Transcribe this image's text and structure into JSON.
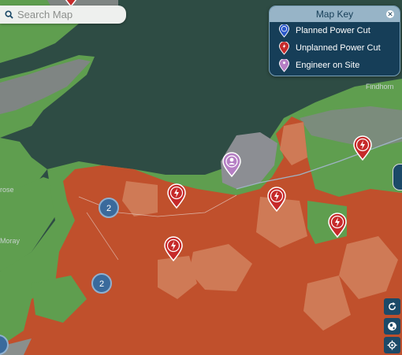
{
  "search": {
    "placeholder": "Search Map"
  },
  "map_key": {
    "title": "Map Key",
    "items": [
      {
        "label": "Planned Power Cut",
        "icon": "planned-power-cut-icon",
        "color": "#2a57c9"
      },
      {
        "label": "Unplanned Power Cut",
        "icon": "unplanned-power-cut-icon",
        "color": "#c62a2a"
      },
      {
        "label": "Engineer on Site",
        "icon": "engineer-on-site-icon",
        "color": "#b57ec4"
      }
    ]
  },
  "places": {
    "findhorn": "Findhorn",
    "rose": "rose",
    "moray": "Moray"
  },
  "clusters": {
    "cluster_a": "2",
    "cluster_b": "2"
  },
  "colors": {
    "sea": "#2e4c44",
    "land": "#5f9e4f",
    "urban": "#7f8583",
    "unplanned_area": "#c0502c",
    "unplanned_light": "#cf7a56",
    "key_bg": "#163e58"
  }
}
